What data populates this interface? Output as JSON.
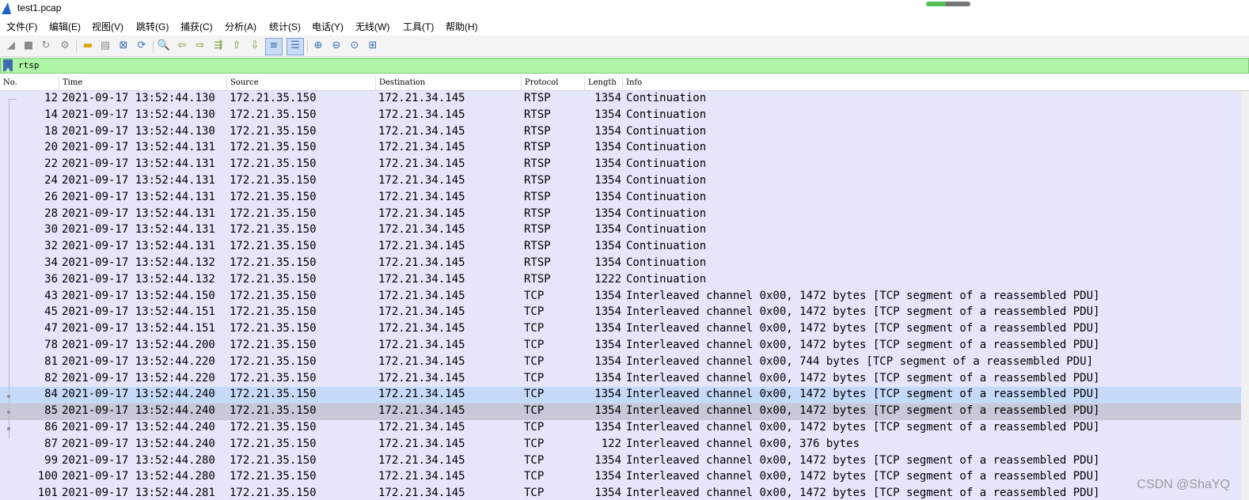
{
  "window": {
    "title": "test1.pcap",
    "progress_percent": 45
  },
  "menu": [
    "文件(F)",
    "编辑(E)",
    "视图(V)",
    "跳转(G)",
    "捕获(C)",
    "分析(A)",
    "统计(S)",
    "电话(Y)",
    "无线(W)",
    "工具(T)",
    "帮助(H)"
  ],
  "toolbar": {
    "icons": [
      "shark-fin-start-icon",
      "stop-square-icon",
      "restart-capture-icon",
      "capture-options-gear-icon",
      "open-file-folder-icon",
      "save-file-icon",
      "close-file-icon",
      "reload-file-icon",
      "find-packet-magnifier-icon",
      "go-back-arrow-icon",
      "go-forward-arrow-icon",
      "go-to-packet-icon",
      "go-first-packet-icon",
      "go-last-packet-icon",
      "auto-scroll-icon",
      "colorize-lines-icon",
      "zoom-in-icon",
      "zoom-out-icon",
      "zoom-normal-icon",
      "resize-columns-icon"
    ]
  },
  "filter": {
    "value": "rtsp"
  },
  "columns": [
    "No.",
    "Time",
    "Source",
    "Destination",
    "Protocol",
    "Length",
    "Info"
  ],
  "packets": [
    {
      "no": "12",
      "time": "2021-09-17 13:52:44.130",
      "src": "172.21.35.150",
      "dst": "172.21.34.145",
      "proto": "RTSP",
      "len": "1354",
      "info": "Continuation",
      "state": "normal"
    },
    {
      "no": "14",
      "time": "2021-09-17 13:52:44.130",
      "src": "172.21.35.150",
      "dst": "172.21.34.145",
      "proto": "RTSP",
      "len": "1354",
      "info": "Continuation",
      "state": "normal"
    },
    {
      "no": "18",
      "time": "2021-09-17 13:52:44.130",
      "src": "172.21.35.150",
      "dst": "172.21.34.145",
      "proto": "RTSP",
      "len": "1354",
      "info": "Continuation",
      "state": "normal"
    },
    {
      "no": "20",
      "time": "2021-09-17 13:52:44.131",
      "src": "172.21.35.150",
      "dst": "172.21.34.145",
      "proto": "RTSP",
      "len": "1354",
      "info": "Continuation",
      "state": "normal"
    },
    {
      "no": "22",
      "time": "2021-09-17 13:52:44.131",
      "src": "172.21.35.150",
      "dst": "172.21.34.145",
      "proto": "RTSP",
      "len": "1354",
      "info": "Continuation",
      "state": "normal"
    },
    {
      "no": "24",
      "time": "2021-09-17 13:52:44.131",
      "src": "172.21.35.150",
      "dst": "172.21.34.145",
      "proto": "RTSP",
      "len": "1354",
      "info": "Continuation",
      "state": "normal"
    },
    {
      "no": "26",
      "time": "2021-09-17 13:52:44.131",
      "src": "172.21.35.150",
      "dst": "172.21.34.145",
      "proto": "RTSP",
      "len": "1354",
      "info": "Continuation",
      "state": "normal"
    },
    {
      "no": "28",
      "time": "2021-09-17 13:52:44.131",
      "src": "172.21.35.150",
      "dst": "172.21.34.145",
      "proto": "RTSP",
      "len": "1354",
      "info": "Continuation",
      "state": "normal"
    },
    {
      "no": "30",
      "time": "2021-09-17 13:52:44.131",
      "src": "172.21.35.150",
      "dst": "172.21.34.145",
      "proto": "RTSP",
      "len": "1354",
      "info": "Continuation",
      "state": "normal"
    },
    {
      "no": "32",
      "time": "2021-09-17 13:52:44.131",
      "src": "172.21.35.150",
      "dst": "172.21.34.145",
      "proto": "RTSP",
      "len": "1354",
      "info": "Continuation",
      "state": "normal"
    },
    {
      "no": "34",
      "time": "2021-09-17 13:52:44.132",
      "src": "172.21.35.150",
      "dst": "172.21.34.145",
      "proto": "RTSP",
      "len": "1354",
      "info": "Continuation",
      "state": "normal"
    },
    {
      "no": "36",
      "time": "2021-09-17 13:52:44.132",
      "src": "172.21.35.150",
      "dst": "172.21.34.145",
      "proto": "RTSP",
      "len": "1222",
      "info": "Continuation",
      "state": "normal"
    },
    {
      "no": "43",
      "time": "2021-09-17 13:52:44.150",
      "src": "172.21.35.150",
      "dst": "172.21.34.145",
      "proto": "TCP",
      "len": "1354",
      "info": "Interleaved channel 0x00, 1472 bytes [TCP segment of a reassembled PDU]",
      "state": "normal"
    },
    {
      "no": "45",
      "time": "2021-09-17 13:52:44.151",
      "src": "172.21.35.150",
      "dst": "172.21.34.145",
      "proto": "TCP",
      "len": "1354",
      "info": "Interleaved channel 0x00, 1472 bytes [TCP segment of a reassembled PDU]",
      "state": "normal"
    },
    {
      "no": "47",
      "time": "2021-09-17 13:52:44.151",
      "src": "172.21.35.150",
      "dst": "172.21.34.145",
      "proto": "TCP",
      "len": "1354",
      "info": "Interleaved channel 0x00, 1472 bytes [TCP segment of a reassembled PDU]",
      "state": "normal"
    },
    {
      "no": "78",
      "time": "2021-09-17 13:52:44.200",
      "src": "172.21.35.150",
      "dst": "172.21.34.145",
      "proto": "TCP",
      "len": "1354",
      "info": "Interleaved channel 0x00, 1472 bytes [TCP segment of a reassembled PDU]",
      "state": "normal"
    },
    {
      "no": "81",
      "time": "2021-09-17 13:52:44.220",
      "src": "172.21.35.150",
      "dst": "172.21.34.145",
      "proto": "TCP",
      "len": "1354",
      "info": "Interleaved channel 0x00, 744 bytes [TCP segment of a reassembled PDU]",
      "state": "normal"
    },
    {
      "no": "82",
      "time": "2021-09-17 13:52:44.220",
      "src": "172.21.35.150",
      "dst": "172.21.34.145",
      "proto": "TCP",
      "len": "1354",
      "info": "Interleaved channel 0x00, 1472 bytes [TCP segment of a reassembled PDU]",
      "state": "normal"
    },
    {
      "no": "84",
      "time": "2021-09-17 13:52:44.240",
      "src": "172.21.35.150",
      "dst": "172.21.34.145",
      "proto": "TCP",
      "len": "1354",
      "info": "Interleaved channel 0x00, 1472 bytes [TCP segment of a reassembled PDU]",
      "state": "selected"
    },
    {
      "no": "85",
      "time": "2021-09-17 13:52:44.240",
      "src": "172.21.35.150",
      "dst": "172.21.34.145",
      "proto": "TCP",
      "len": "1354",
      "info": "Interleaved channel 0x00, 1472 bytes [TCP segment of a reassembled PDU]",
      "state": "marked"
    },
    {
      "no": "86",
      "time": "2021-09-17 13:52:44.240",
      "src": "172.21.35.150",
      "dst": "172.21.34.145",
      "proto": "TCP",
      "len": "1354",
      "info": "Interleaved channel 0x00, 1472 bytes [TCP segment of a reassembled PDU]",
      "state": "normal"
    },
    {
      "no": "87",
      "time": "2021-09-17 13:52:44.240",
      "src": "172.21.35.150",
      "dst": "172.21.34.145",
      "proto": "TCP",
      "len": "122",
      "info": "Interleaved channel 0x00, 376 bytes",
      "state": "normal"
    },
    {
      "no": "99",
      "time": "2021-09-17 13:52:44.280",
      "src": "172.21.35.150",
      "dst": "172.21.34.145",
      "proto": "TCP",
      "len": "1354",
      "info": "Interleaved channel 0x00, 1472 bytes [TCP segment of a reassembled PDU]",
      "state": "normal"
    },
    {
      "no": "100",
      "time": "2021-09-17 13:52:44.280",
      "src": "172.21.35.150",
      "dst": "172.21.34.145",
      "proto": "TCP",
      "len": "1354",
      "info": "Interleaved channel 0x00, 1472 bytes [TCP segment of a reassembled PDU]",
      "state": "normal"
    },
    {
      "no": "101",
      "time": "2021-09-17 13:52:44.281",
      "src": "172.21.35.150",
      "dst": "172.21.34.145",
      "proto": "TCP",
      "len": "1354",
      "info": "Interleaved channel 0x00, 1472 bytes [TCP segment of a reassembled PDU]",
      "state": "normal"
    }
  ],
  "colors": {
    "row_bg": "#e6e6fb",
    "selected_bg": "#c5d9f8",
    "marked_bg": "#c8c8d8",
    "filter_bg": "#aff5a6"
  },
  "watermark": "CSDN @ShaYQ"
}
